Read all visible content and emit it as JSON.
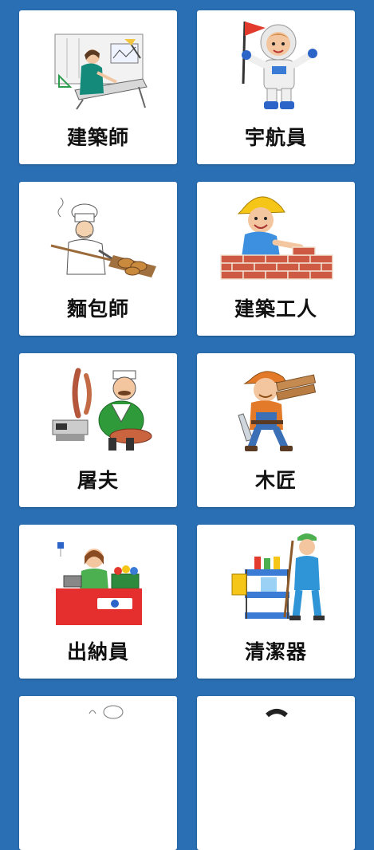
{
  "cards": [
    {
      "label": "建築師",
      "icon": "architect-icon"
    },
    {
      "label": "宇航員",
      "icon": "astronaut-icon"
    },
    {
      "label": "麵包師",
      "icon": "baker-icon"
    },
    {
      "label": "建築工人",
      "icon": "construction-worker-icon"
    },
    {
      "label": "屠夫",
      "icon": "butcher-icon"
    },
    {
      "label": "木匠",
      "icon": "carpenter-icon"
    },
    {
      "label": "出納員",
      "icon": "cashier-icon"
    },
    {
      "label": "清潔器",
      "icon": "cleaner-icon"
    },
    {
      "label": "",
      "icon": "chef-icon"
    },
    {
      "label": "",
      "icon": "person-icon"
    }
  ],
  "colors": {
    "background": "#2a6fb3",
    "card": "#ffffff",
    "label": "#111111"
  }
}
